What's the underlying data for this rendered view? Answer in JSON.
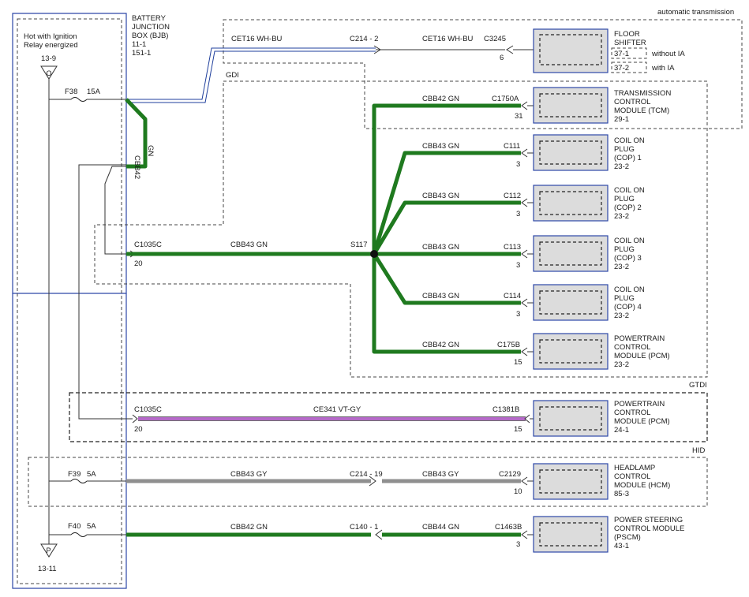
{
  "bjb": {
    "hot_line1": "Hot with Ignition",
    "hot_line2": "Relay energized",
    "ref_top": "13-9",
    "ref_bottom": "13-11",
    "letter_top": "O",
    "letter_bottom": "P",
    "name1": "BATTERY",
    "name2": "JUNCTION",
    "name3": "BOX (BJB)",
    "ref1": "11-1",
    "ref2": "151-1",
    "fuse_f38": "F38",
    "fuse_f38_amp": "15A",
    "fuse_f39": "F39",
    "fuse_f39_amp": "5A",
    "fuse_f40": "F40",
    "fuse_f40_amp": "5A"
  },
  "zones": {
    "automatic": "automatic transmission",
    "gdi": "GDI",
    "gtdi": "GTDI",
    "hid": "HID"
  },
  "wires": {
    "cet16_left": "CET16  WH-BU",
    "c214_2": "C214  -  2",
    "cet16_right": "CET16 WH-BU",
    "c3245": "C3245",
    "c3245_pin": "6",
    "cbb42_vertical": "CBB42",
    "gn_vertical": "GN",
    "c1035c_a": "C1035C",
    "c1035c_a_pin": "20",
    "cbb43_main": "CBB43   GN",
    "s117": "S117",
    "tcm_wire": "CBB42   GN",
    "c1750a": "C1750A",
    "c1750a_pin": "31",
    "cop1_wire": "CBB43   GN",
    "c111": "C111",
    "c111_pin": "3",
    "cop2_wire": "CBB43   GN",
    "c112": "C112",
    "c112_pin": "3",
    "cop3_wire": "CBB43   GN",
    "c113": "C113",
    "c113_pin": "3",
    "cop4_wire": "CBB43   GN",
    "c114": "C114",
    "c114_pin": "3",
    "pcm1_wire": "CBB42   GN",
    "c175b": "C175B",
    "c175b_pin": "15",
    "c1035c_b": "C1035C",
    "c1035c_b_pin": "20",
    "ce341": "CE341   VT-GY",
    "c1381b": "C1381B",
    "c1381b_pin": "15",
    "hcm_left": "CBB43   GY",
    "c214_19": "C214  -  19",
    "hcm_right": "CBB43   GY",
    "c2129": "C2129",
    "c2129_pin": "10",
    "pscm_left": "CBB42   GN",
    "c140_1": "C140  -  1",
    "pscm_right": "CBB44   GN",
    "c1463b": "C1463B",
    "c1463b_pin": "3"
  },
  "modules": {
    "floor_shifter": {
      "l1": "FLOOR",
      "l2": "SHIFTER",
      "opt1_ref": "37-1",
      "opt1": "without IA",
      "opt2_ref": "37-2",
      "opt2": "with IA"
    },
    "tcm": {
      "l1": "TRANSMISSION",
      "l2": "CONTROL",
      "l3": "MODULE (TCM)",
      "ref": "29-1"
    },
    "cop1": {
      "l1": "COIL ON",
      "l2": "PLUG",
      "l3": "(COP) 1",
      "ref": "23-2"
    },
    "cop2": {
      "l1": "COIL ON",
      "l2": "PLUG",
      "l3": "(COP) 2",
      "ref": "23-2"
    },
    "cop3": {
      "l1": "COIL ON",
      "l2": "PLUG",
      "l3": "(COP) 3",
      "ref": "23-2"
    },
    "cop4": {
      "l1": "COIL ON",
      "l2": "PLUG",
      "l3": "(COP) 4",
      "ref": "23-2"
    },
    "pcm_gdi": {
      "l1": "POWERTRAIN",
      "l2": "CONTROL",
      "l3": "MODULE (PCM)",
      "ref": "23-2"
    },
    "pcm_gtdi": {
      "l1": "POWERTRAIN",
      "l2": "CONTROL",
      "l3": "MODULE (PCM)",
      "ref": "24-1"
    },
    "hcm": {
      "l1": "HEADLAMP",
      "l2": "CONTROL",
      "l3": "MODULE (HCM)",
      "ref": "85-3"
    },
    "pscm": {
      "l1": "POWER STEERING",
      "l2": "CONTROL MODULE",
      "l3": "(PSCM)",
      "ref": "43-1"
    }
  }
}
